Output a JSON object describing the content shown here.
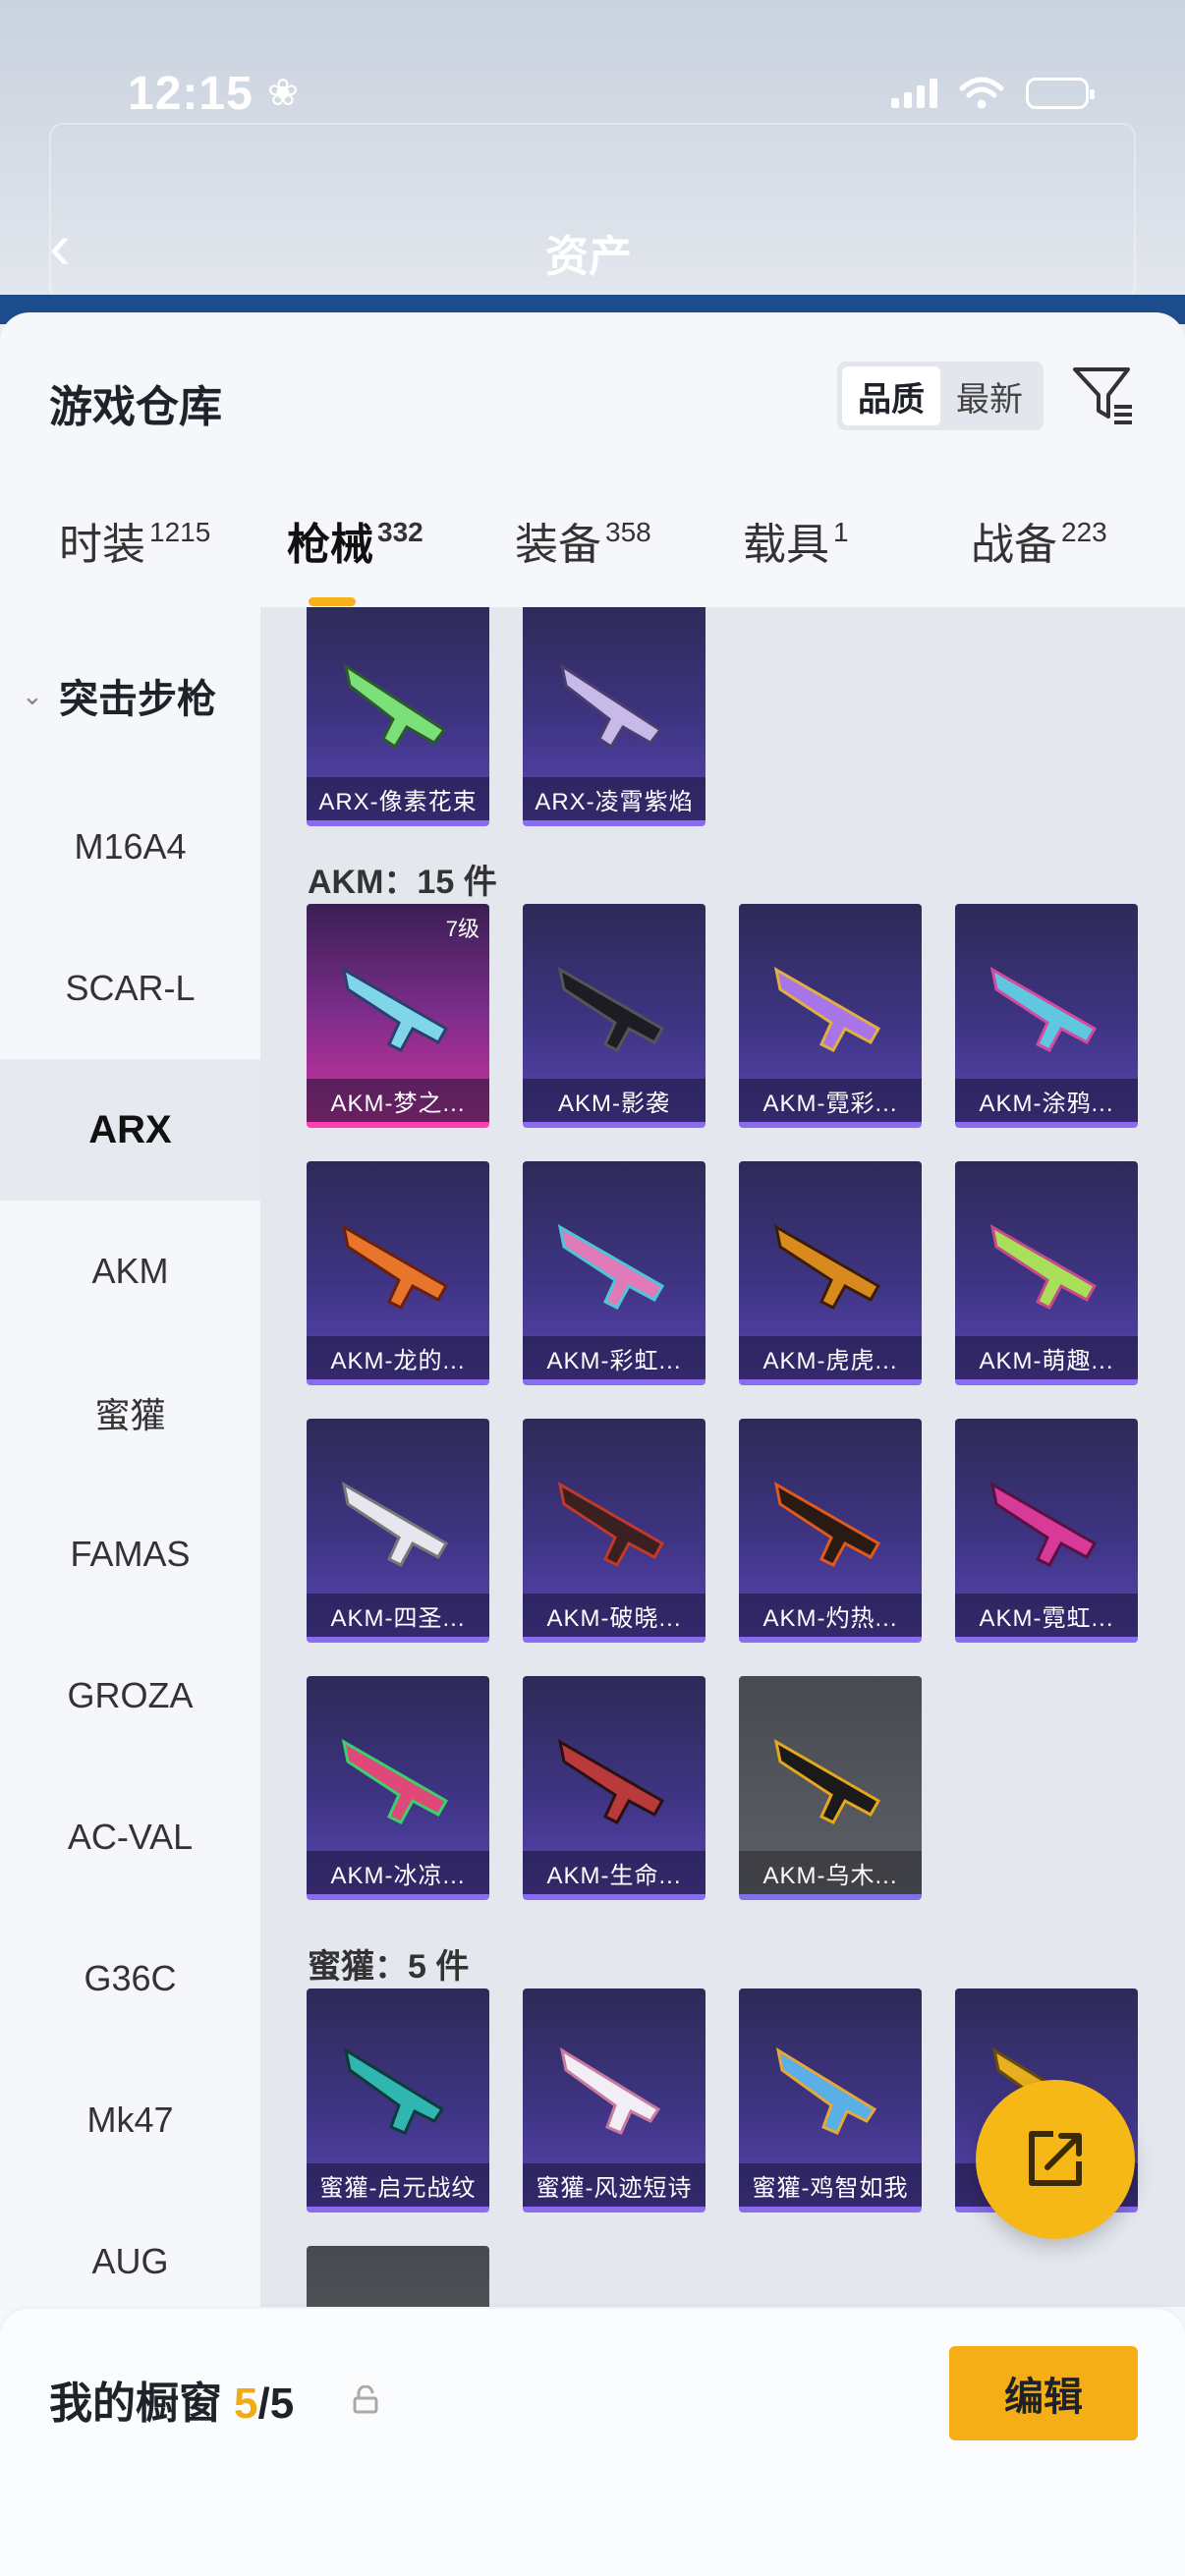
{
  "status_bar": {
    "time": "12:15"
  },
  "header": {
    "title": "资产"
  },
  "warehouse": {
    "title": "游戏仓库",
    "sort_options": [
      "品质",
      "最新"
    ],
    "tabs": [
      {
        "label": "时装",
        "count": "1215"
      },
      {
        "label": "枪械",
        "count": "332"
      },
      {
        "label": "装备",
        "count": "358"
      },
      {
        "label": "载具",
        "count": "1"
      },
      {
        "label": "战备",
        "count": "223"
      }
    ]
  },
  "sidebar": {
    "category": "突击步枪",
    "items": [
      "M16A4",
      "SCAR-L",
      "ARX",
      "AKM",
      "蜜獾",
      "FAMAS",
      "GROZA",
      "AC-VAL",
      "G36C",
      "Mk47",
      "AUG"
    ],
    "active": "ARX"
  },
  "grid": {
    "arx_items": [
      "ARX-像素花束",
      "ARX-凌霄紫焰"
    ],
    "akm_label": "AKM：15 件",
    "akm_items": [
      "AKM-梦之...",
      "AKM-影袭",
      "AKM-霓彩...",
      "AKM-涂鸦...",
      "AKM-龙的...",
      "AKM-彩虹...",
      "AKM-虎虎...",
      "AKM-萌趣...",
      "AKM-四圣...",
      "AKM-破晓...",
      "AKM-灼热...",
      "AKM-霓虹...",
      "AKM-冰凉...",
      "AKM-生命...",
      "AKM-乌木..."
    ],
    "akm_first_level": "7级",
    "honeybadger_label": "蜜獾：5 件",
    "honeybadger_items": [
      "蜜獾-启元战纹",
      "蜜獾-风迹短诗",
      "蜜獾-鸡智如我",
      "蜜"
    ]
  },
  "showcase": {
    "label": "我的橱窗",
    "count": "5",
    "total": "5",
    "edit_label": "编辑"
  },
  "colors": {
    "accent": "#f6ae16",
    "card_purple": "#3e3483",
    "card_pink": "#d0329a",
    "card_grey": "#55575e"
  }
}
